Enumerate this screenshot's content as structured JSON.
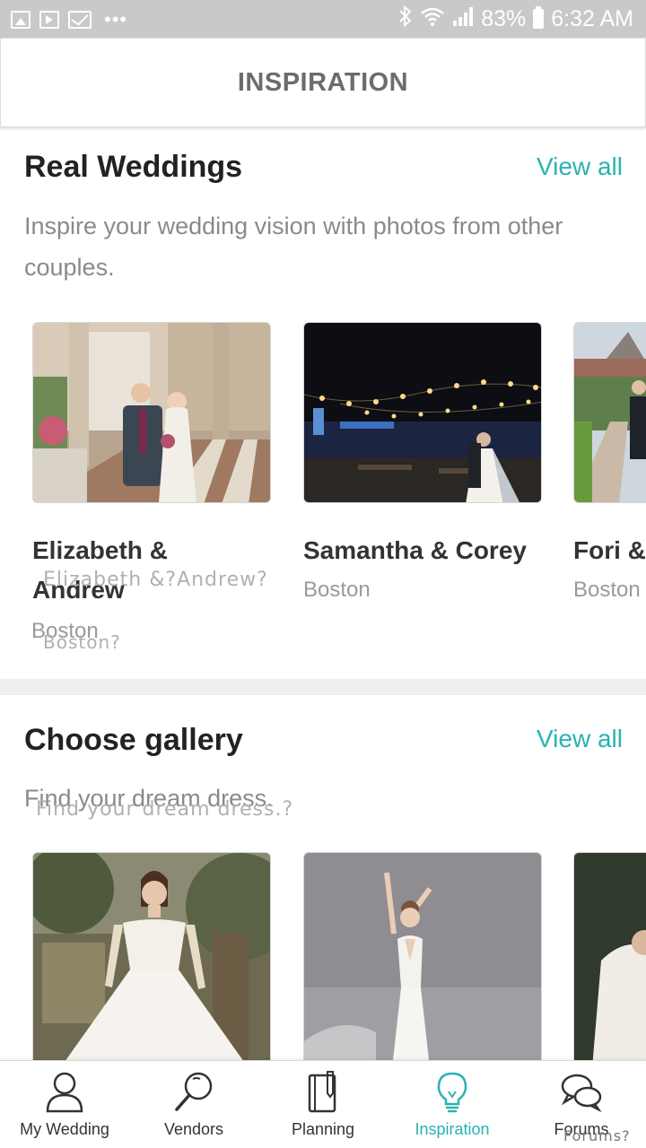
{
  "status_bar": {
    "battery": "83%",
    "time": "6:32 AM",
    "icons": [
      "picture-icon",
      "play-store-icon",
      "mail-icon",
      "more-dots-icon",
      "bluetooth-icon",
      "wifi-icon",
      "signal-icon",
      "battery-icon"
    ]
  },
  "header": {
    "title": "INSPIRATION"
  },
  "real_weddings": {
    "title": "Real Weddings",
    "view_all": "View all",
    "description": "Inspire your wedding vision with photos from other couples.",
    "cards": [
      {
        "title": "Elizabeth & Andrew",
        "location": "Boston",
        "ghost_title": "Elizabeth &?Andrew?",
        "ghost_location": "Boston?"
      },
      {
        "title": "Samantha & Corey",
        "location": "Boston"
      },
      {
        "title": "Fori &",
        "location": "Boston"
      }
    ]
  },
  "choose_gallery": {
    "title": "Choose gallery",
    "view_all": "View all",
    "description": "Find your dream dress.",
    "ghost_description": "Find your dream dress.?"
  },
  "bottom_nav": {
    "items": [
      {
        "label": "My Wedding",
        "icon": "person-icon"
      },
      {
        "label": "Vendors",
        "icon": "search-icon"
      },
      {
        "label": "Planning",
        "icon": "notebook-icon"
      },
      {
        "label": "Inspiration",
        "icon": "lightbulb-icon"
      },
      {
        "label": "Forums",
        "icon": "chat-bubbles-icon"
      }
    ],
    "active": "Inspiration",
    "ghost_label": "Forums?"
  },
  "colors": {
    "accent": "#29b3b1",
    "status_bar": "#c9c9c9",
    "text_dark": "#222222",
    "text_muted": "#8a8a8a"
  }
}
